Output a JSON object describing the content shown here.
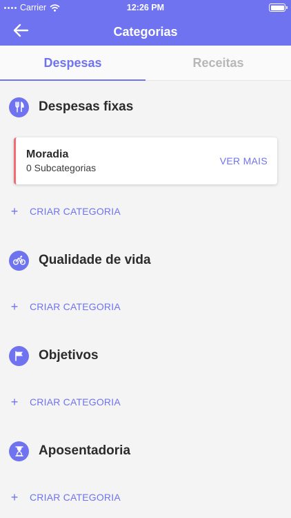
{
  "status_bar": {
    "carrier": "Carrier",
    "time": "12:26 PM"
  },
  "header": {
    "title": "Categorias"
  },
  "tabs": [
    {
      "label": "Despesas"
    },
    {
      "label": "Receitas"
    }
  ],
  "colors": {
    "accent": "#6f73f0",
    "card_marker": "#f06b72"
  },
  "sections": [
    {
      "title": "Despesas fixas",
      "icon": "fork-knife-icon",
      "items": [
        {
          "name": "Moradia",
          "subtitle": "0 Subcategorias",
          "action": "VER MAIS"
        }
      ],
      "create_label": "CRIAR CATEGORIA"
    },
    {
      "title": "Qualidade de vida",
      "icon": "bicycle-icon",
      "create_label": "CRIAR CATEGORIA"
    },
    {
      "title": "Objetivos",
      "icon": "flag-icon",
      "create_label": "CRIAR CATEGORIA"
    },
    {
      "title": "Aposentadoria",
      "icon": "hourglass-icon",
      "create_label": "CRIAR CATEGORIA"
    }
  ]
}
